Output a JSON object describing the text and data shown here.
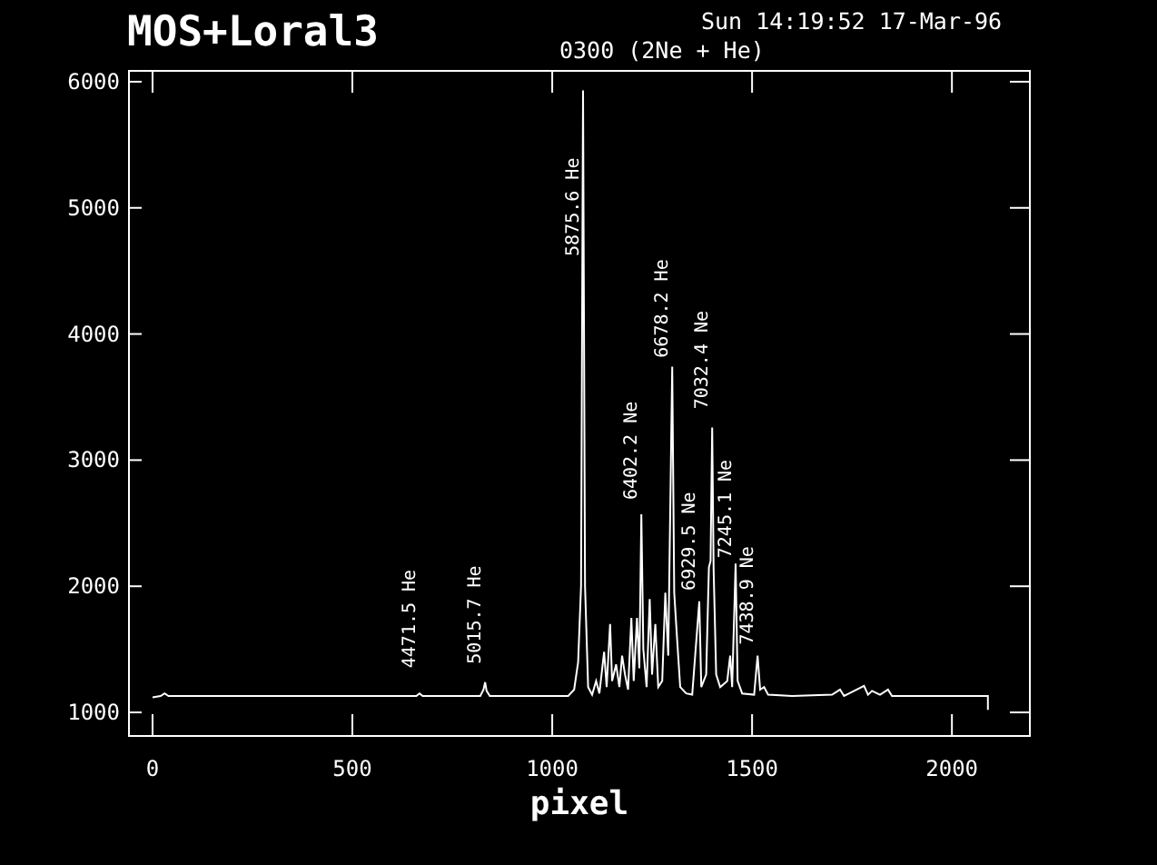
{
  "header": {
    "instrument": "MOS+Loral3",
    "timestamp": "Sun 14:19:52 17-Mar-96",
    "subtitle": "0300 (2Ne + He)"
  },
  "plot": {
    "chart_data": {
      "type": "line",
      "xlabel": "pixel",
      "xlim": [
        -59,
        2195
      ],
      "ylim": [
        813,
        6086
      ],
      "xticks": [
        0,
        500,
        1000,
        1500,
        2000
      ],
      "yticks": [
        1000,
        2000,
        3000,
        4000,
        5000,
        6000
      ],
      "x": [
        0,
        20,
        30,
        40,
        660,
        668,
        676,
        820,
        828,
        832,
        836,
        844,
        1040,
        1055,
        1065,
        1072,
        1077,
        1082,
        1090,
        1100,
        1110,
        1118,
        1130,
        1136,
        1145,
        1150,
        1160,
        1168,
        1175,
        1182,
        1190,
        1198,
        1204,
        1212,
        1218,
        1223,
        1228,
        1236,
        1244,
        1250,
        1258,
        1265,
        1275,
        1283,
        1290,
        1300,
        1305,
        1312,
        1320,
        1335,
        1350,
        1368,
        1373,
        1385,
        1392,
        1396,
        1400,
        1404,
        1410,
        1420,
        1438,
        1445,
        1450,
        1459,
        1464,
        1475,
        1505,
        1514,
        1520,
        1530,
        1540,
        1600,
        1700,
        1720,
        1730,
        1780,
        1790,
        1800,
        1820,
        1840,
        1850,
        2090,
        2090
      ],
      "series": [
        {
          "color": "#ffffff",
          "values": [
            1120,
            1130,
            1150,
            1130,
            1130,
            1150,
            1130,
            1130,
            1180,
            1240,
            1170,
            1130,
            1130,
            1180,
            1400,
            2000,
            5930,
            2000,
            1200,
            1140,
            1250,
            1150,
            1480,
            1200,
            1700,
            1250,
            1380,
            1200,
            1450,
            1300,
            1180,
            1750,
            1250,
            1750,
            1350,
            2570,
            1500,
            1200,
            1900,
            1300,
            1700,
            1200,
            1250,
            1950,
            1450,
            3740,
            1950,
            1600,
            1200,
            1150,
            1140,
            1880,
            1200,
            1300,
            2150,
            2200,
            3260,
            2130,
            1300,
            1200,
            1250,
            1450,
            1200,
            2180,
            1250,
            1150,
            1140,
            1450,
            1180,
            1200,
            1140,
            1130,
            1140,
            1180,
            1130,
            1210,
            1140,
            1170,
            1140,
            1180,
            1130,
            1130,
            1020
          ]
        }
      ],
      "annotations": [
        {
          "x": 668,
          "y": 1150,
          "text": "4471.5 He"
        },
        {
          "x": 832,
          "y": 1240,
          "text": "5015.7 He"
        },
        {
          "x": 1077,
          "y": 4617,
          "text": "5875.6 He"
        },
        {
          "x": 1223,
          "y": 2570,
          "text": "6402.2 Ne"
        },
        {
          "x": 1300,
          "y": 3740,
          "text": "6678.2 He"
        },
        {
          "x": 1368,
          "y": 1880,
          "text": "6929.5 Ne"
        },
        {
          "x": 1400,
          "y": 3260,
          "text": "7032.4 Ne"
        },
        {
          "x": 1459,
          "y": 2180,
          "text": "7245.1 Ne"
        },
        {
          "x": 1514,
          "y": 1450,
          "text": "7438.9 Ne"
        }
      ]
    }
  }
}
